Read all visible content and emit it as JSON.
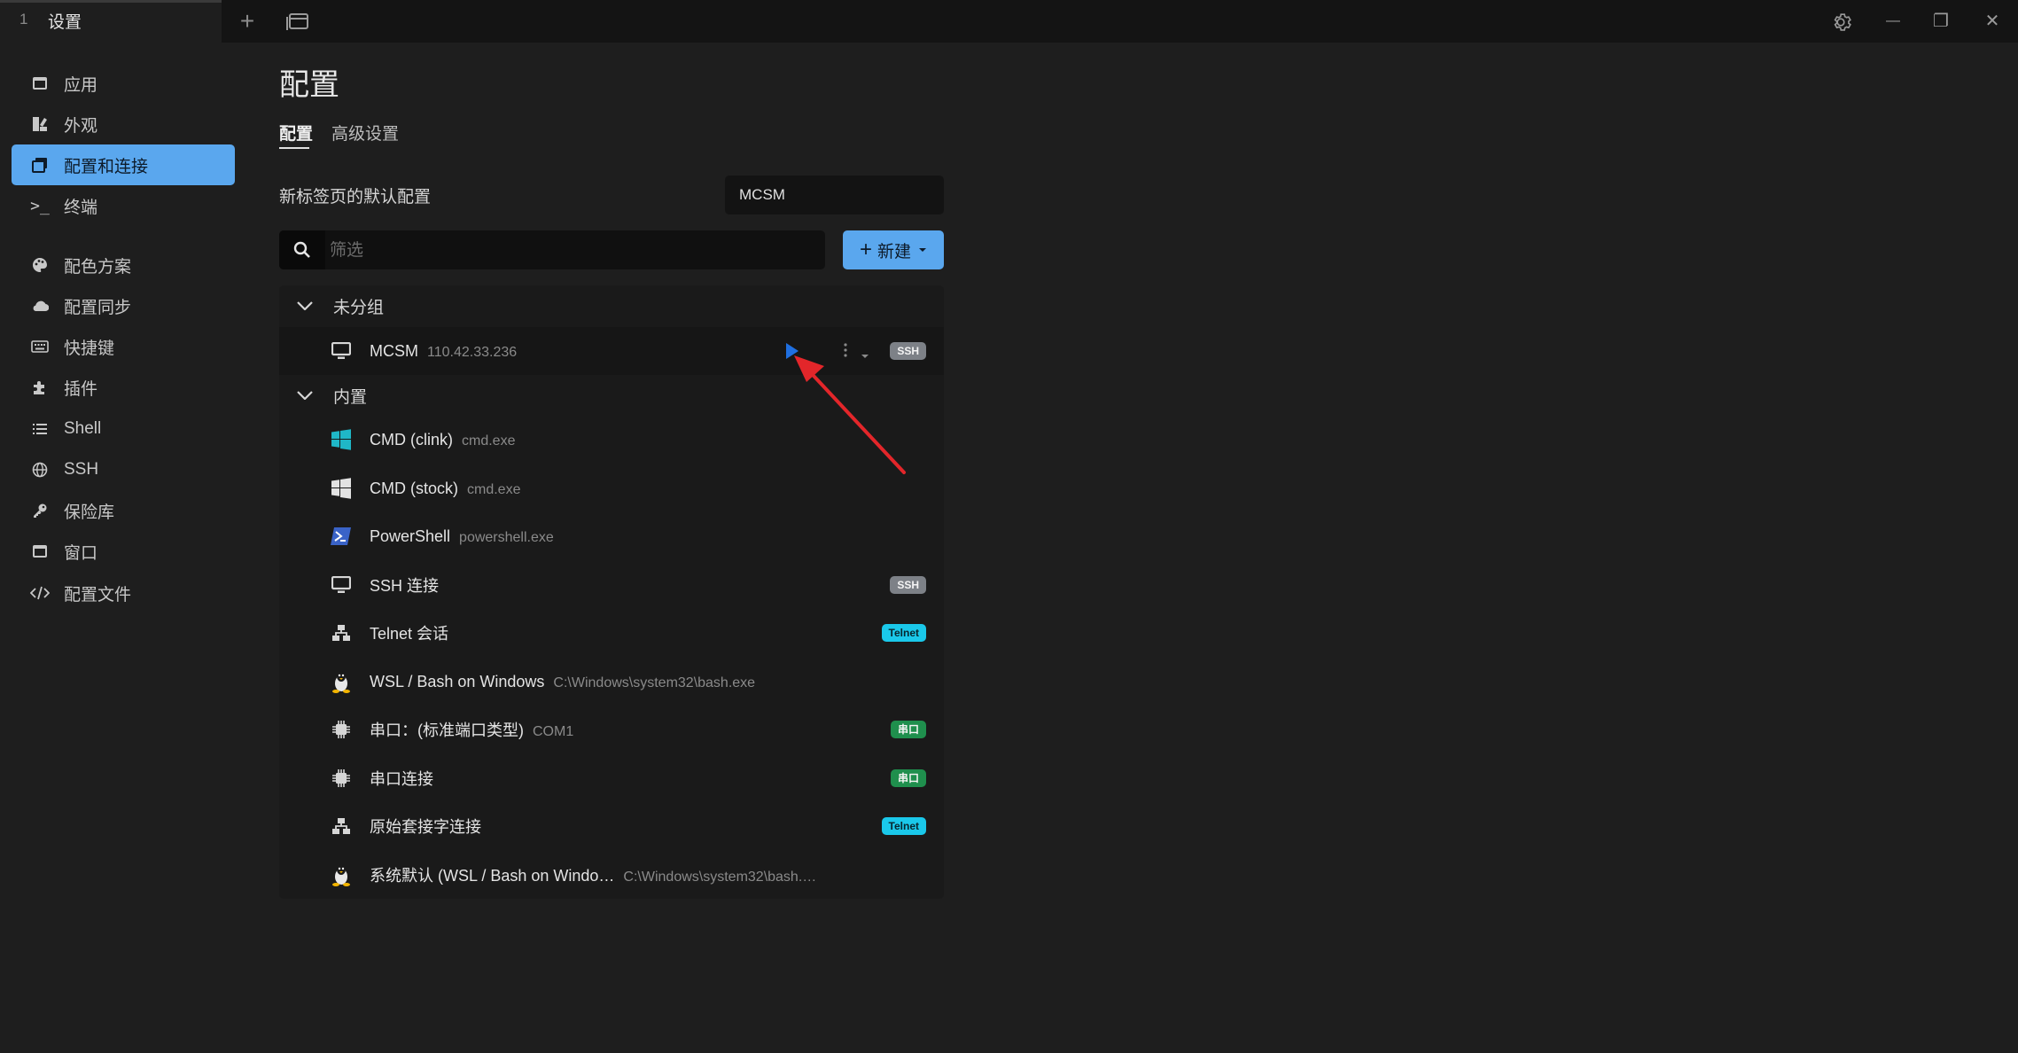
{
  "titlebar": {
    "tab_number": "1",
    "tab_title": "设置",
    "new_tab_symbol": "+",
    "restore_symbol": "❐",
    "minimize_symbol": "—",
    "close_symbol": "✕"
  },
  "sidebar": {
    "items": [
      {
        "label": "应用",
        "icon": "app-window-icon"
      },
      {
        "label": "外观",
        "icon": "appearance-icon"
      },
      {
        "label": "配置和连接",
        "icon": "profiles-icon",
        "active": true
      },
      {
        "label": "终端",
        "icon": "terminal-icon"
      },
      {
        "label": "配色方案",
        "icon": "palette-icon"
      },
      {
        "label": "配置同步",
        "icon": "cloud-icon"
      },
      {
        "label": "快捷键",
        "icon": "keyboard-icon"
      },
      {
        "label": "插件",
        "icon": "puzzle-icon"
      },
      {
        "label": "Shell",
        "icon": "list-icon"
      },
      {
        "label": "SSH",
        "icon": "globe-icon"
      },
      {
        "label": "保险库",
        "icon": "key-icon"
      },
      {
        "label": "窗口",
        "icon": "window-icon"
      },
      {
        "label": "配置文件",
        "icon": "code-icon"
      }
    ],
    "terminal_glyph": ">_"
  },
  "main": {
    "title": "配置",
    "tabs": [
      {
        "label": "配置",
        "active": true
      },
      {
        "label": "高级设置"
      }
    ],
    "default_profile_label": "新标签页的默认配置",
    "default_profile_value": "MCSM",
    "search_placeholder": "筛选",
    "new_button_label": "新建",
    "new_button_plus": "+",
    "groups": [
      {
        "name": "未分组",
        "profiles": [
          {
            "name": "MCSM",
            "desc": "110.42.33.236",
            "icon": "monitor-icon",
            "badge": "SSH",
            "badge_type": "ssh"
          }
        ]
      },
      {
        "name": "内置",
        "profiles": [
          {
            "name": "CMD (clink)",
            "desc": "cmd.exe",
            "icon": "windows-color-icon"
          },
          {
            "name": "CMD (stock)",
            "desc": "cmd.exe",
            "icon": "windows-icon"
          },
          {
            "name": "PowerShell",
            "desc": "powershell.exe",
            "icon": "powershell-icon"
          },
          {
            "name": "SSH 连接",
            "desc": "",
            "icon": "monitor-icon",
            "badge": "SSH",
            "badge_type": "ssh"
          },
          {
            "name": "Telnet 会话",
            "desc": "",
            "icon": "network-icon",
            "badge": "Telnet",
            "badge_type": "telnet"
          },
          {
            "name": "WSL / Bash on Windows",
            "desc": "C:\\Windows\\system32\\bash.exe",
            "icon": "linux-icon"
          },
          {
            "name": "串口：(标准端口类型)",
            "desc": "COM1",
            "icon": "chip-icon",
            "badge": "串口",
            "badge_type": "serial"
          },
          {
            "name": "串口连接",
            "desc": "",
            "icon": "chip-icon",
            "badge": "串口",
            "badge_type": "serial"
          },
          {
            "name": "原始套接字连接",
            "desc": "",
            "icon": "network-icon",
            "badge": "Telnet",
            "badge_type": "telnet"
          },
          {
            "name": "系统默认 (WSL / Bash on Windo…",
            "desc": "C:\\Windows\\system32\\bash.…",
            "icon": "linux-icon"
          }
        ]
      }
    ]
  },
  "colors": {
    "accent": "#5aa7ee",
    "annotation_arrow": "#e3262a",
    "play_button": "#1f6fe0"
  }
}
